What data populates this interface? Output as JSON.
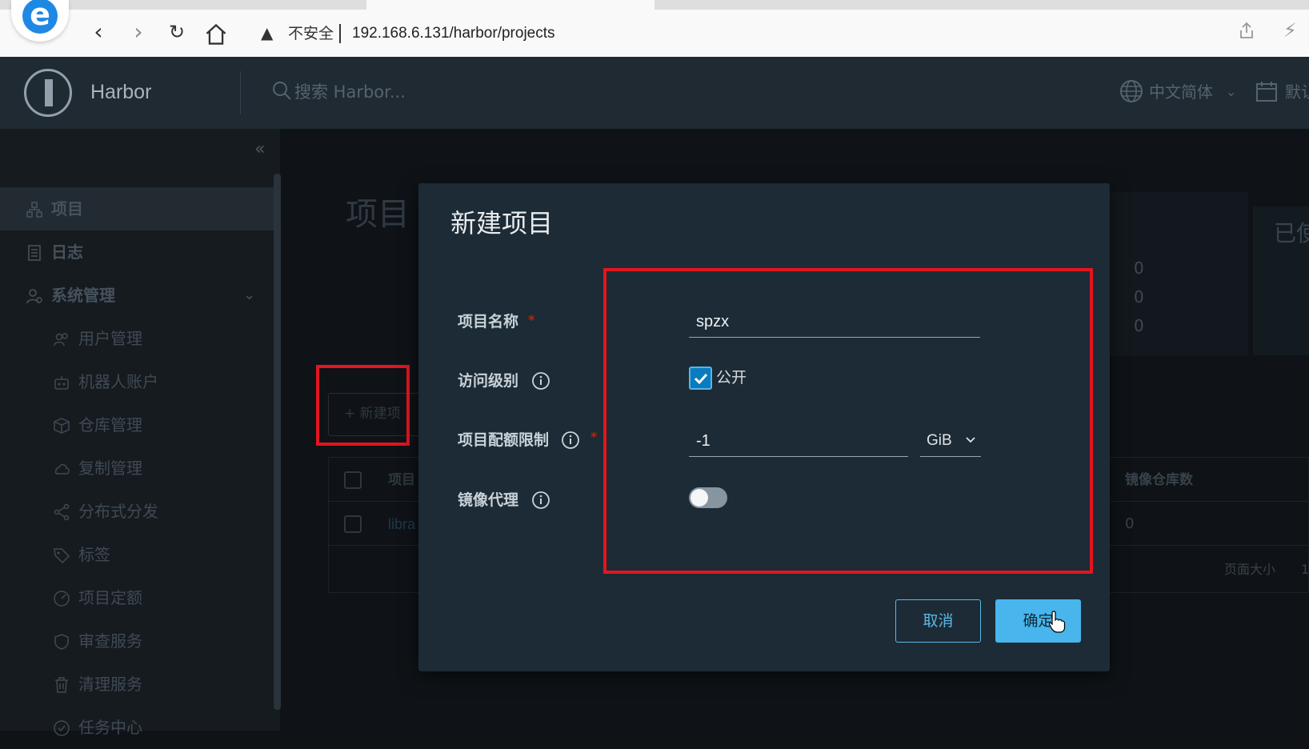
{
  "browser": {
    "security_label": "不安全",
    "url": "192.168.6.131/harbor/projects"
  },
  "header": {
    "app_name": "Harbor",
    "search_placeholder": "搜索 Harbor...",
    "language": "中文简体",
    "date_format": "默认"
  },
  "sidebar": {
    "items": [
      {
        "label": "项目",
        "icon": "projects-icon",
        "active": true
      },
      {
        "label": "日志",
        "icon": "logs-icon"
      },
      {
        "label": "系统管理",
        "icon": "admin-icon",
        "expanded": true
      },
      {
        "label": "用户管理",
        "icon": "users-icon"
      },
      {
        "label": "机器人账户",
        "icon": "robot-icon"
      },
      {
        "label": "仓库管理",
        "icon": "registry-icon"
      },
      {
        "label": "复制管理",
        "icon": "replication-icon"
      },
      {
        "label": "分布式分发",
        "icon": "distribution-icon"
      },
      {
        "label": "标签",
        "icon": "tag-icon"
      },
      {
        "label": "项目定额",
        "icon": "quota-icon"
      },
      {
        "label": "审查服务",
        "icon": "shield-icon"
      },
      {
        "label": "清理服务",
        "icon": "trash-icon"
      },
      {
        "label": "任务中心",
        "icon": "task-icon"
      }
    ]
  },
  "page": {
    "title": "项目",
    "used_label": "已使",
    "stats": [
      "0",
      "0",
      "0"
    ],
    "new_project_button": "+ 新建项",
    "table": {
      "col_project": "项目",
      "col_repo_count": "镜像仓库数",
      "row_project": "libra",
      "row_repo_count": "0"
    },
    "page_size_label": "页面大小",
    "page_size_value": "1"
  },
  "modal": {
    "title": "新建项目",
    "fields": {
      "name_label": "项目名称",
      "name_value": "spzx",
      "access_label": "访问级别",
      "public_label": "公开",
      "public_checked": true,
      "quota_label": "项目配额限制",
      "quota_value": "-1",
      "quota_unit": "GiB",
      "proxy_label": "镜像代理",
      "proxy_enabled": false
    },
    "cancel_label": "取消",
    "ok_label": "确定"
  },
  "colors": {
    "annotation_red": "#e3151f",
    "primary": "#48b5ec",
    "modal_bg": "#1c2b35"
  }
}
